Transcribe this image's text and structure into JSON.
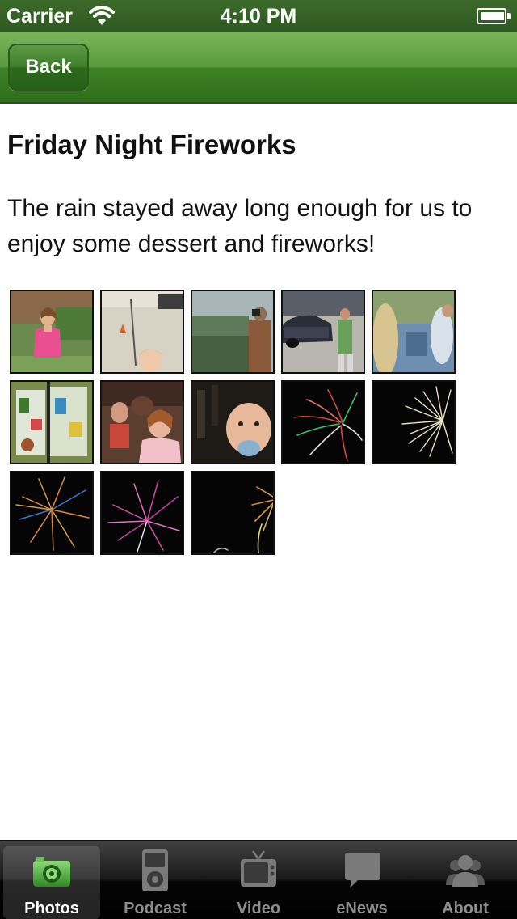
{
  "status_bar": {
    "carrier": "Carrier",
    "time": "4:10 PM"
  },
  "nav_bar": {
    "back_label": "Back"
  },
  "content": {
    "title": "Friday Night Fireworks",
    "description": "The rain stayed away long enough for us to enjoy some dessert and fireworks!"
  },
  "gallery": {
    "photos": [
      {
        "name": "woman-in-pink"
      },
      {
        "name": "girl-with-balloon"
      },
      {
        "name": "man-with-camera"
      },
      {
        "name": "man-by-cars"
      },
      {
        "name": "crowd-blurred"
      },
      {
        "name": "painted-box"
      },
      {
        "name": "girls-close-up"
      },
      {
        "name": "baby-close-up"
      },
      {
        "name": "fireworks-red-green"
      },
      {
        "name": "fireworks-white"
      },
      {
        "name": "fireworks-orange"
      },
      {
        "name": "fireworks-purple"
      },
      {
        "name": "fireworks-gold-edge"
      }
    ]
  },
  "tab_bar": {
    "selected": "Photos",
    "items": [
      {
        "label": "Photos",
        "icon": "camera-icon"
      },
      {
        "label": "Podcast",
        "icon": "ipod-icon"
      },
      {
        "label": "Video",
        "icon": "tv-icon"
      },
      {
        "label": "eNews",
        "icon": "speech-bubble-icon"
      },
      {
        "label": "About",
        "icon": "people-icon"
      }
    ]
  },
  "colors": {
    "bar_green": "#3f8224",
    "status_green": "#2e5921",
    "tab_black": "#0a0a0a",
    "selected_icon_green": "#4fa23a"
  }
}
